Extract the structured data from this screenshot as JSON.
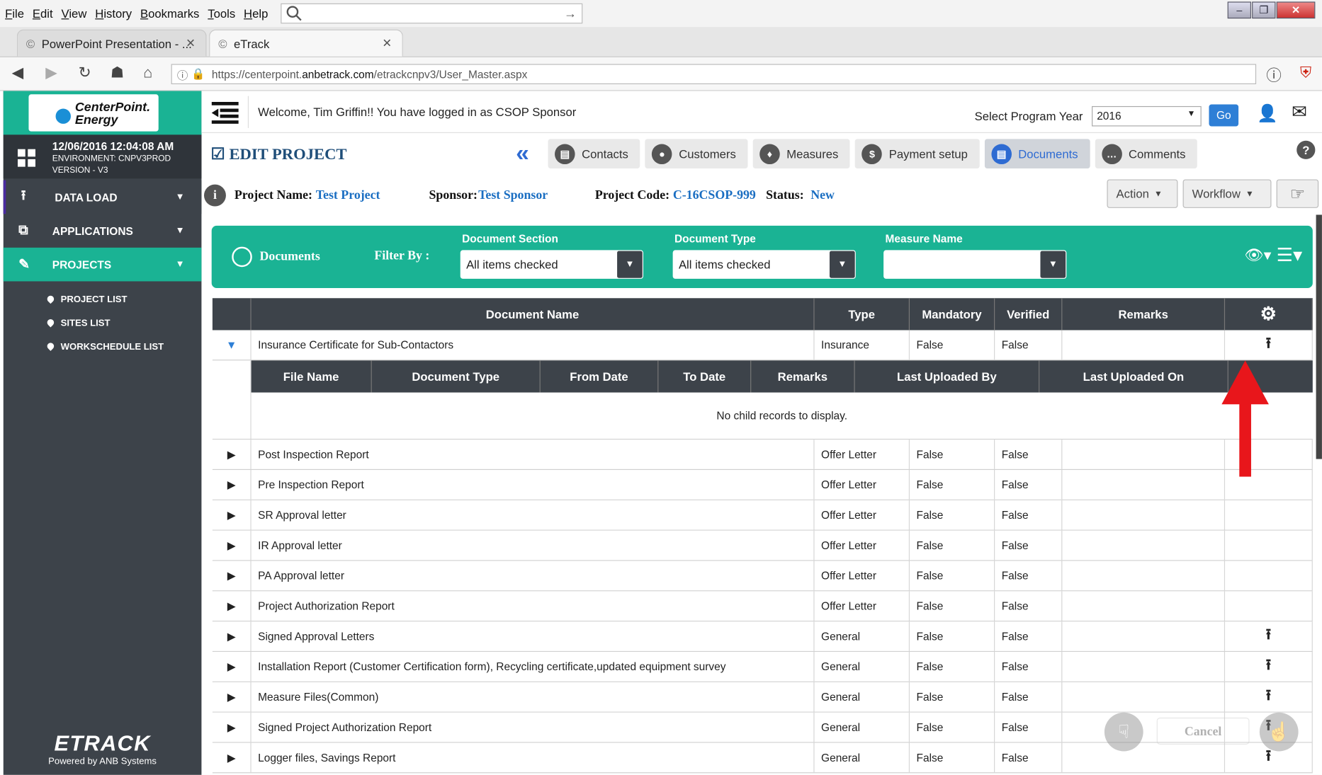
{
  "browser": {
    "menu": [
      "File",
      "Edit",
      "View",
      "History",
      "Bookmarks",
      "Tools",
      "Help"
    ],
    "tabs": [
      {
        "label": "PowerPoint Presentation - ..."
      },
      {
        "label": "eTrack"
      }
    ],
    "url_prefix": "https://centerpoint.",
    "url_domain": "anbetrack.com",
    "url_path": "/etrackcnpv3/User_Master.aspx"
  },
  "sidebar": {
    "logo_line1": "CenterPoint.",
    "logo_line2": "Energy",
    "datetime": "12/06/2016 12:04:08 AM",
    "environment": "ENVIRONMENT: CNPV3PROD",
    "version": "VERSION - V3",
    "items": [
      {
        "label": "DATA LOAD"
      },
      {
        "label": "APPLICATIONS"
      },
      {
        "label": "PROJECTS"
      }
    ],
    "subitems": [
      {
        "label": "PROJECT LIST"
      },
      {
        "label": "SITES LIST"
      },
      {
        "label": "WORKSCHEDULE LIST"
      }
    ],
    "brand": "ETRACK",
    "powered": "Powered by ANB Systems"
  },
  "header": {
    "welcome": "Welcome, Tim Griffin!! You have logged in as CSOP Sponsor",
    "program_year_label": "Select Program Year",
    "program_year": "2016",
    "go": "Go"
  },
  "page_title": "EDIT PROJECT",
  "project_tabs": [
    {
      "label": "Contacts"
    },
    {
      "label": "Customers"
    },
    {
      "label": "Measures"
    },
    {
      "label": "Payment setup"
    },
    {
      "label": "Documents"
    },
    {
      "label": "Comments"
    }
  ],
  "project": {
    "name_label": "Project Name:",
    "name": "Test Project",
    "sponsor_label": "Sponsor:",
    "sponsor": "Test Sponsor",
    "code_label": "Project Code:",
    "code": "C-16CSOP-999",
    "status_label": "Status:",
    "status": "New"
  },
  "actions": {
    "action": "Action",
    "workflow": "Workflow"
  },
  "filter": {
    "title": "Documents",
    "filter_by": "Filter By :",
    "section_label": "Document Section",
    "section_value": "All items checked",
    "type_label": "Document Type",
    "type_value": "All items checked",
    "measure_label": "Measure Name",
    "measure_value": ""
  },
  "grid": {
    "columns": [
      "Document Name",
      "Type",
      "Mandatory",
      "Verified",
      "Remarks"
    ],
    "sub_columns": [
      "File Name",
      "Document Type",
      "From Date",
      "To Date",
      "Remarks",
      "Last Uploaded By",
      "Last Uploaded On"
    ],
    "no_records": "No child records to display.",
    "rows": [
      {
        "name": "Insurance Certificate for Sub-Contactors",
        "type": "Insurance",
        "mandatory": "False",
        "verified": "False"
      },
      {
        "name": "Post Inspection Report",
        "type": "Offer Letter",
        "mandatory": "False",
        "verified": "False"
      },
      {
        "name": "Pre Inspection Report",
        "type": "Offer Letter",
        "mandatory": "False",
        "verified": "False"
      },
      {
        "name": "SR Approval letter",
        "type": "Offer Letter",
        "mandatory": "False",
        "verified": "False"
      },
      {
        "name": "IR Approval letter",
        "type": "Offer Letter",
        "mandatory": "False",
        "verified": "False"
      },
      {
        "name": "PA Approval letter",
        "type": "Offer Letter",
        "mandatory": "False",
        "verified": "False"
      },
      {
        "name": "Project Authorization Report",
        "type": "Offer Letter",
        "mandatory": "False",
        "verified": "False"
      },
      {
        "name": "Signed Approval Letters",
        "type": "General",
        "mandatory": "False",
        "verified": "False"
      },
      {
        "name": "Installation Report (Customer Certification form), Recycling certificate,updated equipment survey",
        "type": "General",
        "mandatory": "False",
        "verified": "False"
      },
      {
        "name": "Measure Files(Common)",
        "type": "General",
        "mandatory": "False",
        "verified": "False"
      },
      {
        "name": "Signed Project Authorization Report",
        "type": "General",
        "mandatory": "False",
        "verified": "False"
      },
      {
        "name": "Logger files, Savings Report",
        "type": "General",
        "mandatory": "False",
        "verified": "False"
      }
    ]
  },
  "footer_cancel": "Cancel"
}
